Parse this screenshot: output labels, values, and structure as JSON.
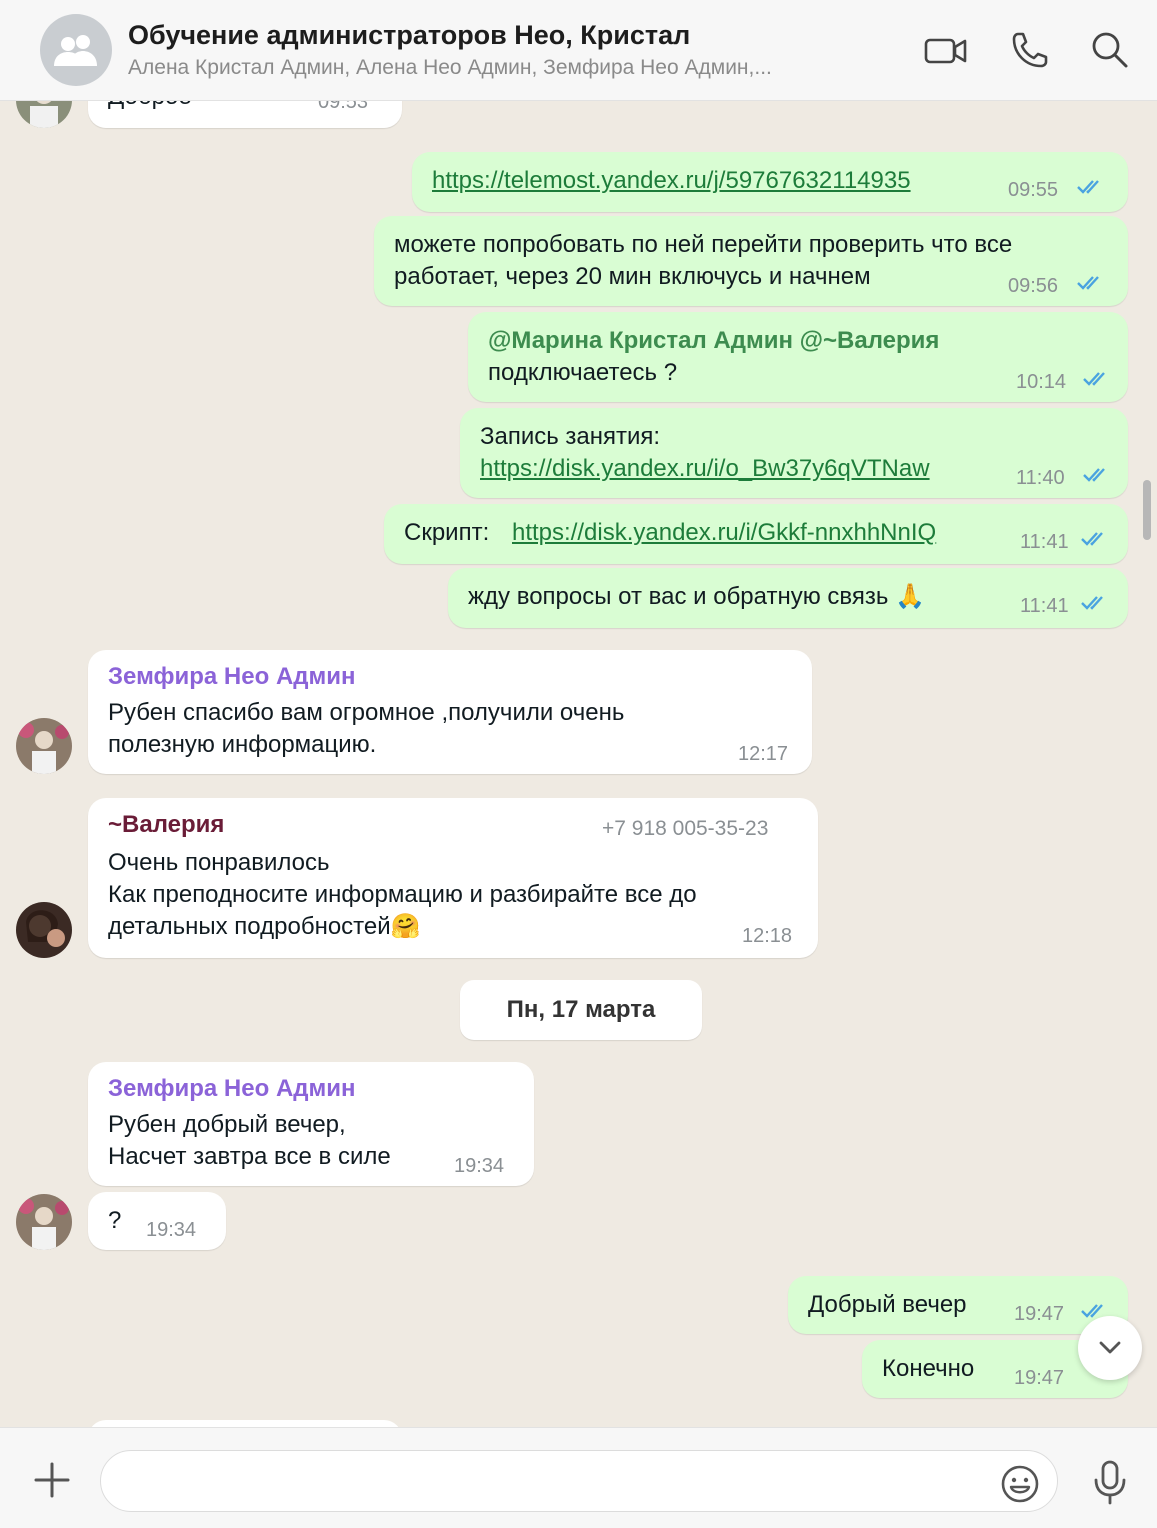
{
  "header": {
    "title": "Обучение администраторов Нео, Кристал",
    "members": "Алена Кристал Админ, Алена Нео Админ, Земфира Нео Админ,..."
  },
  "colors": {
    "outgoing_bubble": "#d9fdd3",
    "incoming_bubble": "#ffffff",
    "read_ticks": "#4aa3e0",
    "link": "#1d7c3a",
    "sender_zemfira": "#8b63d8",
    "sender_valeria": "#6a1c37"
  },
  "messages": {
    "m0": {
      "text": "Доброе",
      "time": "09:53"
    },
    "m1": {
      "link": "https://telemost.yandex.ru/j/59767632114935",
      "time": "09:55"
    },
    "m2": {
      "line1": "можете попробовать по ней перейти проверить что все",
      "line2": "работает, через 20 мин включусь и начнем",
      "time": "09:56"
    },
    "m3": {
      "mention": "@Марина Кристал Админ @~Валерия",
      "line2": "подключаетесь ?",
      "time": "10:14"
    },
    "m4": {
      "line1": "Запись занятия:",
      "link": "https://disk.yandex.ru/i/o_Bw37y6qVTNaw",
      "time": "11:40"
    },
    "m5": {
      "prefix": "Скрипт: ",
      "link": "https://disk.yandex.ru/i/Gkkf-nnxhhNnIQ",
      "time": "11:41"
    },
    "m6": {
      "text": "жду вопросы от вас и обратную связь 🙏",
      "time": "11:41"
    },
    "m7": {
      "sender": "Земфира Нео Админ",
      "line1": "Рубен спасибо вам огромное ,получили очень",
      "line2": "полезную информацию.",
      "time": "12:17"
    },
    "m8": {
      "sender": "~Валерия",
      "phone": "+7 918 005-35-23",
      "line1": "Очень понравилось",
      "line2": "Как преподносите информацию и разбирайте  все до",
      "line3": "детальных подробностей🤗",
      "time": "12:18"
    },
    "date_separator": "Пн, 17 марта",
    "m9": {
      "sender": "Земфира Нео Админ",
      "line1": "Рубен добрый вечер,",
      "line2": "Насчет завтра все в силе",
      "time": "19:34"
    },
    "m10": {
      "text": "?",
      "time": "19:34"
    },
    "m11": {
      "text": "Добрый вечер",
      "time": "19:47"
    },
    "m12": {
      "text": "Конечно",
      "time": "19:47"
    }
  },
  "composer": {
    "placeholder": ""
  },
  "icons": {
    "group_avatar": "group-icon",
    "video": "video-camera-icon",
    "call": "phone-icon",
    "search": "search-icon",
    "plus": "plus-icon",
    "emoji": "emoji-icon",
    "mic": "microphone-icon",
    "scroll_down": "chevron-down-icon",
    "read": "double-check-icon"
  }
}
